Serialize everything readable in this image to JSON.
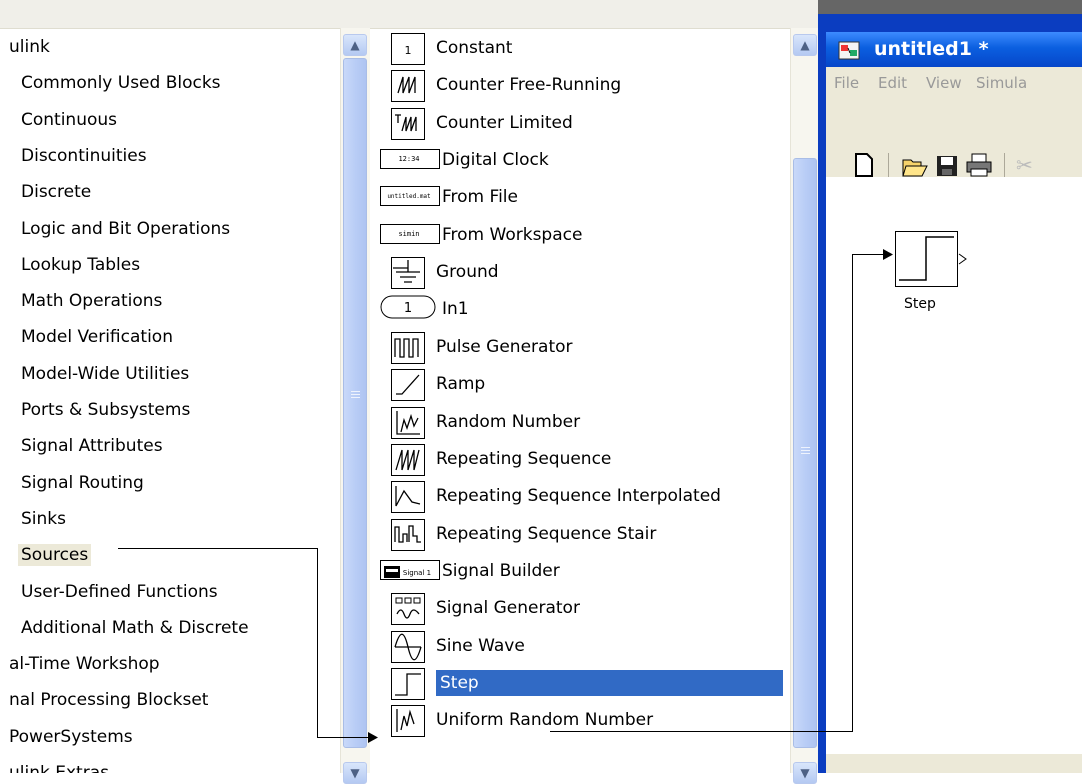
{
  "library_tree": {
    "items": [
      {
        "label": "ulink",
        "selected": false
      },
      {
        "label": "Commonly Used Blocks",
        "selected": false
      },
      {
        "label": "Continuous",
        "selected": false
      },
      {
        "label": "Discontinuities",
        "selected": false
      },
      {
        "label": "Discrete",
        "selected": false
      },
      {
        "label": "Logic and Bit Operations",
        "selected": false
      },
      {
        "label": "Lookup Tables",
        "selected": false
      },
      {
        "label": "Math Operations",
        "selected": false
      },
      {
        "label": "Model Verification",
        "selected": false
      },
      {
        "label": "Model-Wide Utilities",
        "selected": false
      },
      {
        "label": "Ports & Subsystems",
        "selected": false
      },
      {
        "label": "Signal Attributes",
        "selected": false
      },
      {
        "label": "Signal Routing",
        "selected": false
      },
      {
        "label": "Sinks",
        "selected": false
      },
      {
        "label": "Sources",
        "selected": true
      },
      {
        "label": "User-Defined Functions",
        "selected": false
      },
      {
        "label": "Additional Math & Discrete",
        "selected": false
      },
      {
        "label": "al-Time Workshop",
        "selected": false
      },
      {
        "label": "nal Processing Blockset",
        "selected": false
      },
      {
        "label": "PowerSystems",
        "selected": false
      },
      {
        "label": "ulink Extras",
        "selected": false
      }
    ]
  },
  "block_list": {
    "items": [
      {
        "label": "Constant",
        "icon": "constant-icon",
        "icon_text": "1"
      },
      {
        "label": "Counter Free-Running",
        "icon": "counter-free-running-icon",
        "icon_text": "ᴧᴧ"
      },
      {
        "label": "Counter Limited",
        "icon": "counter-limited-icon",
        "icon_text": "ᴧᴧ"
      },
      {
        "label": "Digital Clock",
        "icon": "digital-clock-icon",
        "icon_text": "12:34"
      },
      {
        "label": "From File",
        "icon": "from-file-icon",
        "icon_text": "untitled.mat"
      },
      {
        "label": "From Workspace",
        "icon": "from-workspace-icon",
        "icon_text": "simin"
      },
      {
        "label": "Ground",
        "icon": "ground-icon",
        "icon_text": ""
      },
      {
        "label": "In1",
        "icon": "inport-icon",
        "icon_text": "1"
      },
      {
        "label": "Pulse Generator",
        "icon": "pulse-generator-icon",
        "icon_text": ""
      },
      {
        "label": "Ramp",
        "icon": "ramp-icon",
        "icon_text": ""
      },
      {
        "label": "Random Number",
        "icon": "random-number-icon",
        "icon_text": ""
      },
      {
        "label": "Repeating Sequence",
        "icon": "repeating-sequence-icon",
        "icon_text": ""
      },
      {
        "label": "Repeating Sequence Interpolated",
        "icon": "repeating-sequence-interpolated-icon",
        "icon_text": ""
      },
      {
        "label": "Repeating Sequence Stair",
        "icon": "repeating-sequence-stair-icon",
        "icon_text": ""
      },
      {
        "label": "Signal Builder",
        "icon": "signal-builder-icon",
        "icon_text": "Signal 1"
      },
      {
        "label": "Signal Generator",
        "icon": "signal-generator-icon",
        "icon_text": ""
      },
      {
        "label": "Sine Wave",
        "icon": "sine-wave-icon",
        "icon_text": ""
      },
      {
        "label": "Step",
        "icon": "step-icon",
        "icon_text": "",
        "selected": true
      },
      {
        "label": "Uniform Random Number",
        "icon": "uniform-random-number-icon",
        "icon_text": ""
      }
    ]
  },
  "model_window": {
    "title": "untitled1 *",
    "menu": [
      "File",
      "Edit",
      "View",
      "Simula"
    ],
    "toolbar_icons": [
      "new-icon",
      "open-icon",
      "save-icon",
      "print-icon",
      "cut-icon"
    ],
    "block_name": "Step"
  }
}
